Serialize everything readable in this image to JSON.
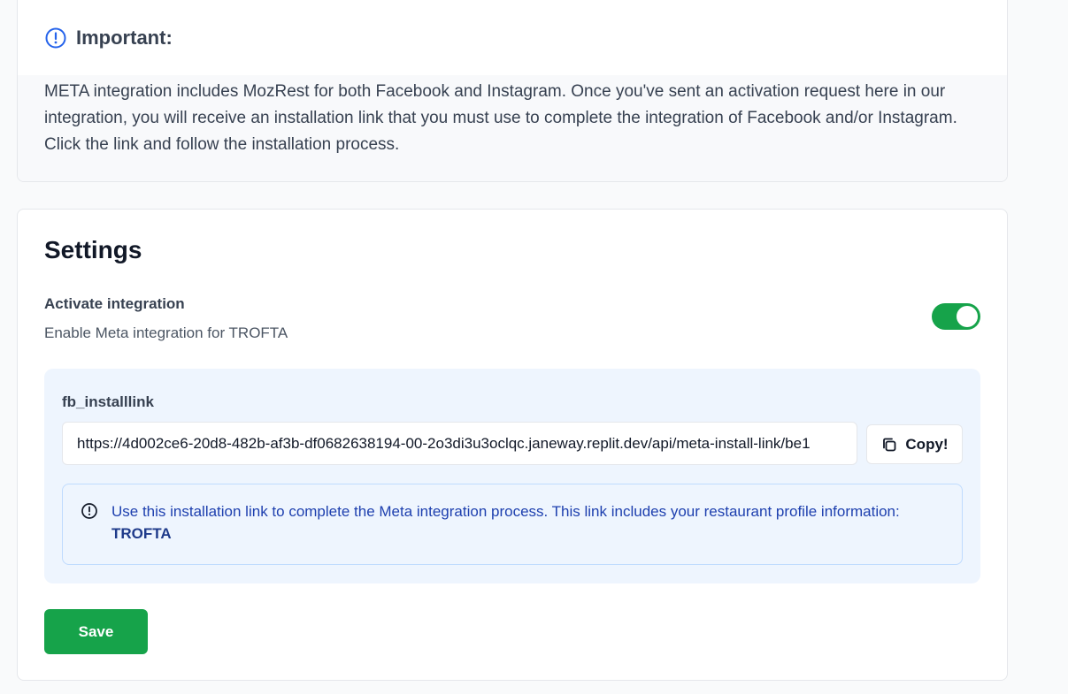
{
  "important": {
    "title": "Important:",
    "icon": "info-circle-icon",
    "body": "META integration includes MozRest for both Facebook and Instagram. Once you've sent an activation request here in our integration, you will receive an installation link that you must use to complete the integration of Facebook and/or Instagram. Click the link and follow the installation process."
  },
  "settings": {
    "title": "Settings",
    "activate_label": "Activate integration",
    "activate_description": "Enable Meta integration for TROFTA",
    "toggle_on": true,
    "link_label": "fb_installlink",
    "link_value": "https://4d002ce6-20d8-482b-af3b-df0682638194-00-2o3di3u3oclqc.janeway.replit.dev/api/meta-install-link/be1",
    "copy_label": "Copy!",
    "alert_text": "Use this installation link to complete the Meta integration process. This link includes your restaurant profile information: ",
    "alert_restaurant": "TROFTA",
    "save_label": "Save"
  },
  "colors": {
    "accent_green": "#16a34a",
    "info_blue": "#2563eb",
    "alert_bg": "#eef5fe"
  }
}
